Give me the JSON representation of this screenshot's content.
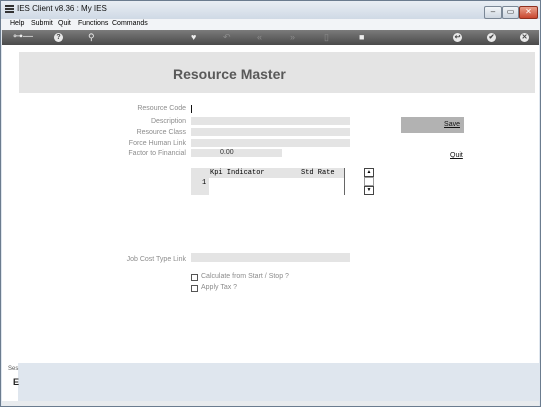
{
  "window": {
    "title": "IES Client v8.36 : My IES",
    "minimize_glyph": "–",
    "maximize_glyph": "▭",
    "close_glyph": "✕"
  },
  "menu": [
    "Help",
    "Submit",
    "Quit",
    "Functions",
    "Commands"
  ],
  "toolbar": {
    "icons": [
      "key-icon",
      "help-icon",
      "search-icon",
      "heart-icon",
      "undo-icon",
      "first-icon",
      "last-icon",
      "trash-icon",
      "new-icon",
      "back-icon",
      "ok-icon",
      "close-icon"
    ],
    "glyphs": {
      "key": "⊶—",
      "help": "?",
      "search": "⚲",
      "heart": "♥",
      "undo": "↶",
      "first": "«",
      "last": "»",
      "trash": "▯",
      "new": "■",
      "back": "↩",
      "ok": "✔",
      "close": "✕"
    }
  },
  "form": {
    "title": "Resource Master",
    "fields": {
      "resource_code": "Resource Code",
      "description": "Description",
      "resource_class": "Resource Class",
      "force_human_link": "Force Human Link",
      "factor_to_financial": "Factor to Financial",
      "factor_value": "0.00",
      "job_cost_type_link": "Job Cost Type Link"
    },
    "grid": {
      "columns": [
        "Kpi Indicator",
        "Std Rate"
      ],
      "rows": [
        "1"
      ]
    },
    "checkboxes": {
      "calc": "Calculate from Start / Stop ?",
      "apply_tax": "Apply Tax ?"
    },
    "save_label": "Save",
    "quit_label": "Quit"
  },
  "sidebar": {
    "label_top": "Ses",
    "label_bottom": "E"
  }
}
